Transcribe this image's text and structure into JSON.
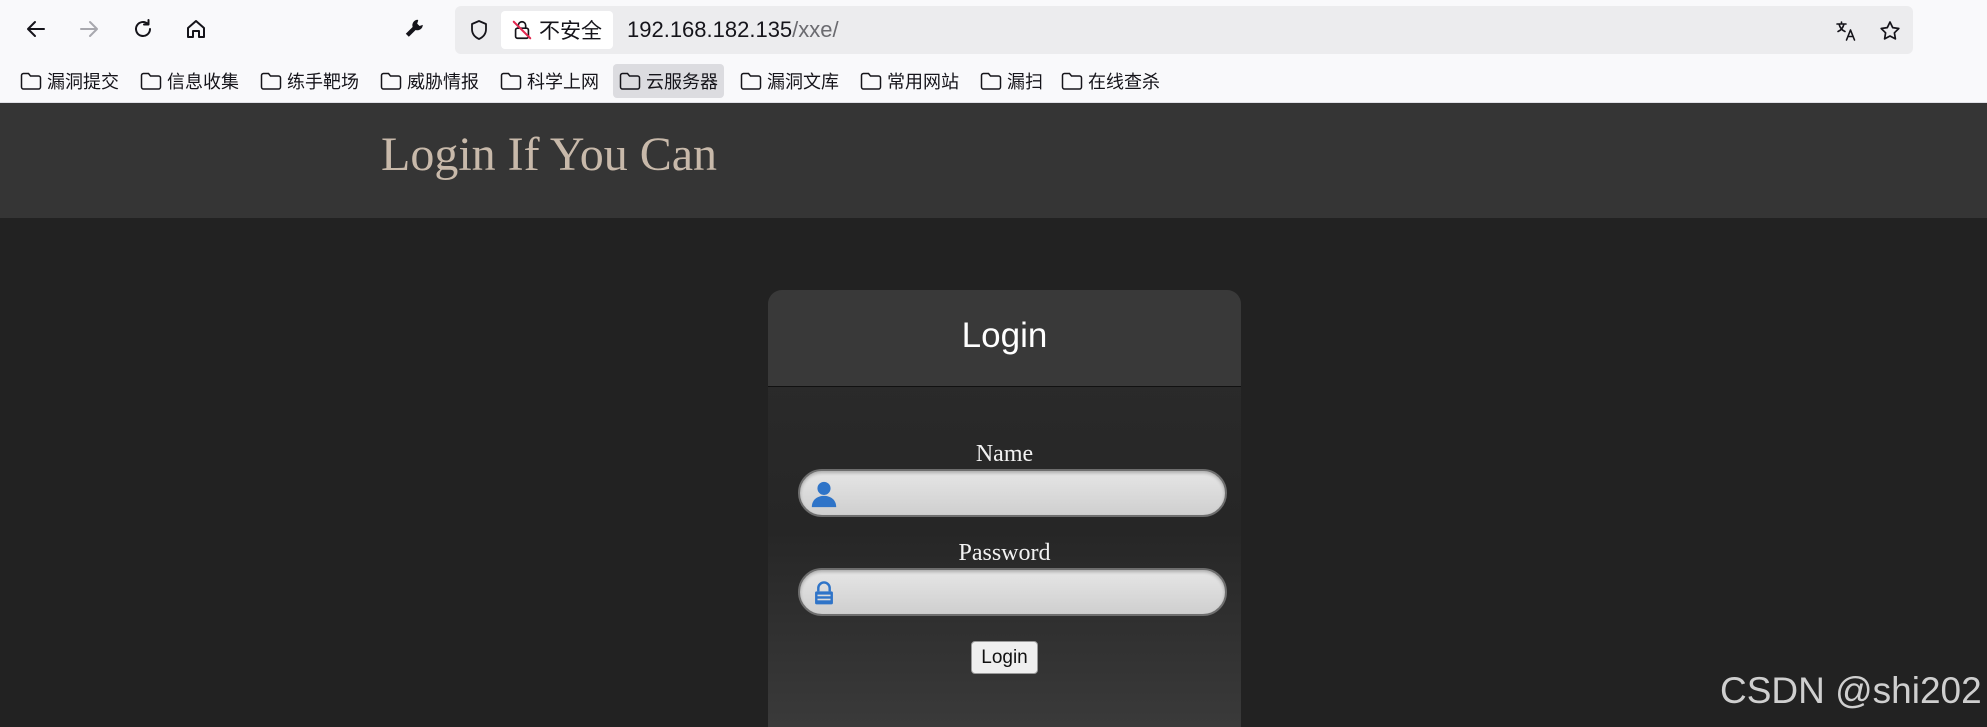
{
  "browser": {
    "url_security": "不安全",
    "url_host": "192.168.182.135",
    "url_path": "/xxe/",
    "bookmarks": [
      {
        "label": "漏洞提交"
      },
      {
        "label": "信息收集"
      },
      {
        "label": "练手靶场"
      },
      {
        "label": "威胁情报"
      },
      {
        "label": "科学上网"
      },
      {
        "label": "云服务器"
      },
      {
        "label": "漏洞文库"
      },
      {
        "label": "常用网站"
      },
      {
        "label": "漏扫"
      },
      {
        "label": "在线查杀"
      }
    ]
  },
  "site": {
    "title": "Login If You Can"
  },
  "login": {
    "title": "Login",
    "name_label": "Name",
    "name_value": "",
    "password_label": "Password",
    "password_value": "",
    "submit_label": "Login"
  },
  "watermark": "CSDN @shi202"
}
